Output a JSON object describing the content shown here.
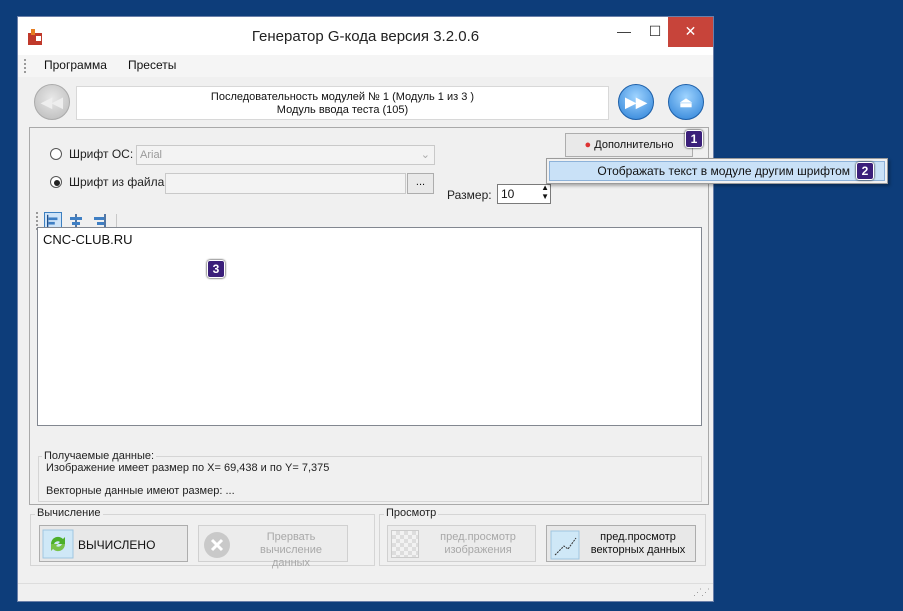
{
  "window": {
    "title": "Генератор G-кода версия 3.2.0.6"
  },
  "menu": {
    "items": [
      "Программа",
      "Пресеты"
    ]
  },
  "sequence": {
    "line1": "Последовательность модулей № 1 (Модуль 1 из 3 )",
    "line2": "Модуль ввода теста (105)"
  },
  "font": {
    "os_font_label": "Шрифт ОС:",
    "os_font_value": "Arial",
    "file_font_label": "Шрифт из файла:",
    "browse_label": "...",
    "size_label": "Размер:",
    "size_value": "10",
    "extra_button": "Дополнительно"
  },
  "popup": {
    "item": "Отображать текст в модуле другим шрифтом"
  },
  "editor": {
    "text": "CNC-CLUB.RU"
  },
  "badges": [
    "1",
    "2",
    "3"
  ],
  "output": {
    "title": "Получаемые данные:",
    "image_size": "Изображение имеет размер по X= 69,438 и по Y= 7,375",
    "vector_size": "Векторные данные имеют размер:  ..."
  },
  "calc": {
    "group_label": "Вычисление",
    "compute_button": "ВЫЧИСЛЕНО",
    "abort_line1": "Прервать вычисление",
    "abort_line2": "данных"
  },
  "preview": {
    "group_label": "Просмотр",
    "image_line1": "пред.просмотр",
    "image_line2": "изображения",
    "vector_line1": "пред.просмотр",
    "vector_line2": "векторных данных"
  },
  "colors": {
    "desktop": "#0d3d7a",
    "badge": "#3b1f7a",
    "close": "#c7443a",
    "accent": "#2a7fd6"
  }
}
